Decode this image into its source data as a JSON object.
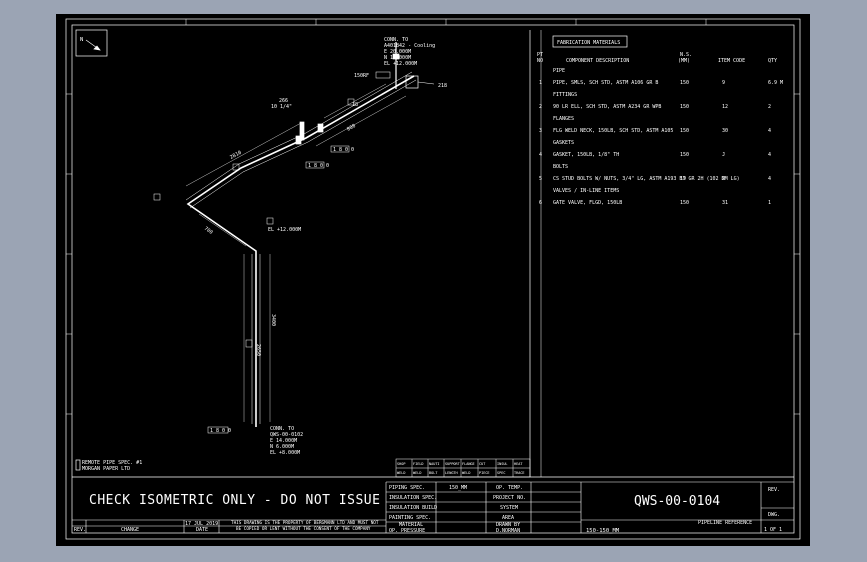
{
  "colors": {
    "background": "#9ba4b4",
    "sheet": "#000000",
    "line": "#ffffff"
  },
  "north": {
    "label": "N"
  },
  "iso": {
    "conn_top": "CONN. TO",
    "conn_top_ref": "A401842 - Cooling",
    "coord_top_e": "E 20.000M",
    "coord_top_n": "N 15.000M",
    "coord_top_el": "EL +12.000M",
    "label_18": "18",
    "weld_top": "150RF",
    "label_218": "218",
    "label_266": "266",
    "label_deg": "10 1/4\"",
    "dim_upper": "1012",
    "dim_upper2": "800",
    "dim_left": "2810",
    "tag_b1": "1 8 0 0",
    "tag_b2": "1 8 0 0",
    "dim_mid": "700",
    "el_mid": "EL +12.000M",
    "dim_vert": "3400",
    "dim_vert2": "2650",
    "tag_bottom": "1 8 0 0",
    "conn_bot": "CONN. TO",
    "conn_bot_ref": "QWS-00-0102",
    "coord_bot_e": "E 14.000M",
    "coord_bot_n": "N 6.000M",
    "coord_bot_el": "EL +8.000M",
    "note_a": "REMOTE PIPE SPEC. #1",
    "note_b": "MORGAN PAPER LTD"
  },
  "bom": {
    "title": "FABRICATION MATERIALS",
    "headers": {
      "pt": "PT",
      "no": "NO",
      "desc": "COMPONENT DESCRIPTION",
      "ns": "N.S.",
      "mm": "(MM)",
      "item": "ITEM CODE",
      "qty": "QTY"
    },
    "sections": [
      {
        "heading": "PIPE",
        "rows": [
          {
            "pt": "1",
            "desc": "PIPE, SMLS, SCH STD, ASTM A106 GR B",
            "ns": "150",
            "code": "9",
            "qty": "6.9 M"
          }
        ]
      },
      {
        "heading": "FITTINGS",
        "rows": [
          {
            "pt": "2",
            "desc": "90 LR ELL, SCH STD, ASTM A234 GR WPB",
            "ns": "150",
            "code": "12",
            "qty": "2"
          }
        ]
      },
      {
        "heading": "FLANGES",
        "rows": [
          {
            "pt": "3",
            "desc": "FLG WELD NECK, 150LB, SCH STD, ASTM A105",
            "ns": "150",
            "code": "30",
            "qty": "4"
          }
        ]
      },
      {
        "heading": "GASKETS",
        "rows": [
          {
            "pt": "4",
            "desc": "GASKET, 150LB, 1/8\" TH",
            "ns": "150",
            "code": "J",
            "qty": "4"
          }
        ]
      },
      {
        "heading": "BOLTS",
        "rows": [
          {
            "pt": "5",
            "desc": "CS STUD BOLTS W/ NUTS, 3/4\" LG, ASTM A193 B7 GR 2H (102 MM LG)",
            "ns": "19",
            "code": "2",
            "qty": "4"
          }
        ]
      },
      {
        "heading": "VALVES / IN-LINE ITEMS",
        "rows": [
          {
            "pt": "6",
            "desc": "GATE VALVE, FLGD, 150LB",
            "ns": "150",
            "code": "31",
            "qty": "1"
          }
        ]
      }
    ]
  },
  "mini_table": {
    "r1": [
      "SHOP",
      "FIELD",
      "NAUTI",
      "SUPPORT",
      "FLANGE",
      "CUT",
      "INSUL",
      "HEAT"
    ],
    "r2": [
      "WELD",
      "WELD",
      "BOLT",
      "LENGTH",
      "WELD",
      "PIECE",
      "SPEC",
      "TRACE"
    ]
  },
  "titleblock": {
    "banner": "CHECK ISOMETRIC ONLY - DO NOT ISSUE",
    "date": "17 JUL 2019",
    "notice_1": "THIS DRAWING IS THE PROPERTY OF BERGMANN LTD AND MUST NOT",
    "notice_2": "BE COPIED OR LENT WITHOUT THE CONSENT OF THE COMPANY",
    "rev_label": "REV.",
    "desc_label": "CHANGE",
    "date_label": "DATE",
    "piping_spec_label": "PIPING SPEC.",
    "piping_spec_value": "150_MM",
    "insul_spec_label": "INSULATION SPEC.",
    "insul_build_label": "INSULATION BUILD",
    "painting_label": "PAINTING SPEC.",
    "material_label": "MATERIAL",
    "op_pressure_label": "OP. PRESSURE",
    "op_temp_label": "OP. TEMP.",
    "project_label": "PROJECT NO.",
    "system_label": "SYSTEM",
    "area_label": "AREA",
    "drawn_label": "DRAWN BY",
    "drawn_value": "D.NORMAN",
    "dwg_number": "QWS-00-0104",
    "pipeline_ref_label": "PIPELINE REFERENCE",
    "pipeline_ref_value": "150-150_MM",
    "rev_col_label": "REV.",
    "dwg_label": "DWG.",
    "sheet_value": "1 OF 1"
  }
}
